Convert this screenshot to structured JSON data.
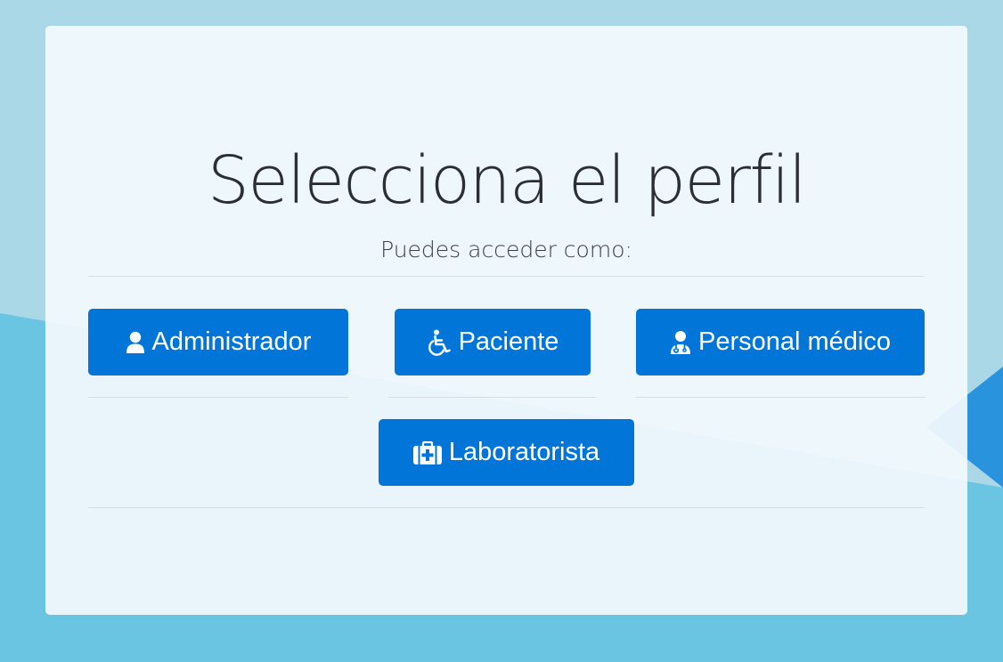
{
  "page": {
    "title": "Selecciona el perfil",
    "subtitle": "Puedes acceder como:"
  },
  "profiles": [
    {
      "label": "Administrador",
      "icon": "user-icon"
    },
    {
      "label": "Paciente",
      "icon": "wheelchair-icon"
    },
    {
      "label": "Personal médico",
      "icon": "doctor-icon"
    },
    {
      "label": "Laboratorista",
      "icon": "medkit-icon"
    }
  ],
  "colors": {
    "button": "#0275d8",
    "background": "#69c5e2",
    "card": "#f3f9fd"
  }
}
